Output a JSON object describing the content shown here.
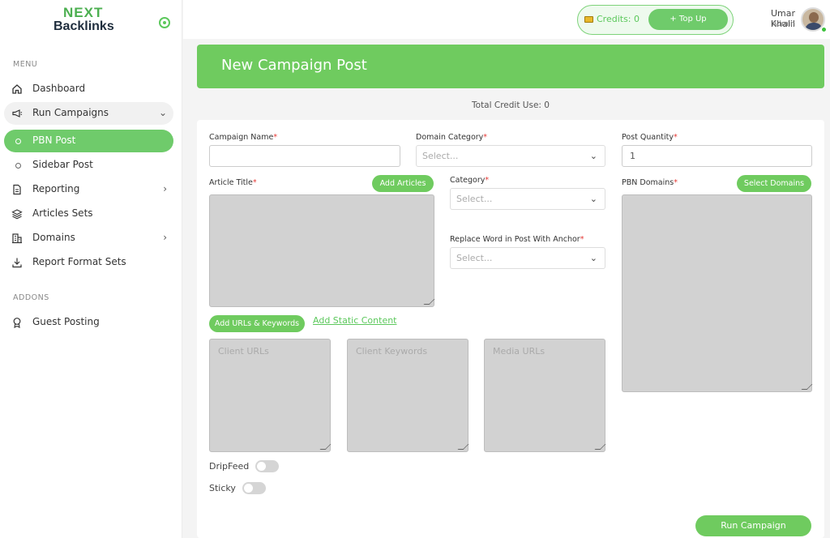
{
  "brand": {
    "line1": "NEXT",
    "line2": "Backlinks"
  },
  "sidebar": {
    "menu_label": "MENU",
    "addons_label": "ADDONS",
    "items": [
      {
        "label": "Dashboard",
        "icon": "home-icon"
      },
      {
        "label": "Run Campaigns",
        "icon": "megaphone-icon",
        "arrow": "⌄"
      },
      {
        "label": "PBN Post",
        "icon": "circle-icon"
      },
      {
        "label": "Sidebar Post",
        "icon": "circle-icon"
      },
      {
        "label": "Reporting",
        "icon": "document-icon",
        "arrow": "›"
      },
      {
        "label": "Articles Sets",
        "icon": "layers-icon"
      },
      {
        "label": "Domains",
        "icon": "building-icon",
        "arrow": "›"
      },
      {
        "label": "Report Format Sets",
        "icon": "download-icon"
      }
    ],
    "addons": [
      {
        "label": "Guest Posting",
        "icon": "award-icon"
      }
    ]
  },
  "header": {
    "credits_label": "Credits: 0",
    "topup_label": "+ Top Up",
    "user_name": "Umar Khalil",
    "user_role": "Admin"
  },
  "page": {
    "title": "New Campaign Post",
    "total_credit": "Total Credit Use: 0"
  },
  "form": {
    "campaign_name_label": "Campaign Name",
    "domain_category_label": "Domain Category",
    "domain_category_placeholder": "Select...",
    "post_quantity_label": "Post Quantity",
    "post_quantity_value": "1",
    "article_title_label": "Article Title",
    "add_articles_label": "Add Articles",
    "category_label": "Category",
    "category_placeholder": "Select...",
    "replace_word_label": "Replace Word in Post With Anchor",
    "replace_word_placeholder": "Select...",
    "pbn_domains_label": "PBN Domains",
    "select_domains_label": "Select Domains",
    "add_urls_label": "Add URLs & Keywords",
    "add_static_label": "Add Static Content",
    "client_urls_placeholder": "Client URLs",
    "client_keywords_placeholder": "Client Keywords",
    "media_urls_placeholder": "Media URLs",
    "dripfeed_label": "DripFeed",
    "sticky_label": "Sticky",
    "run_label": "Run Campaign",
    "required_mark": "*"
  }
}
